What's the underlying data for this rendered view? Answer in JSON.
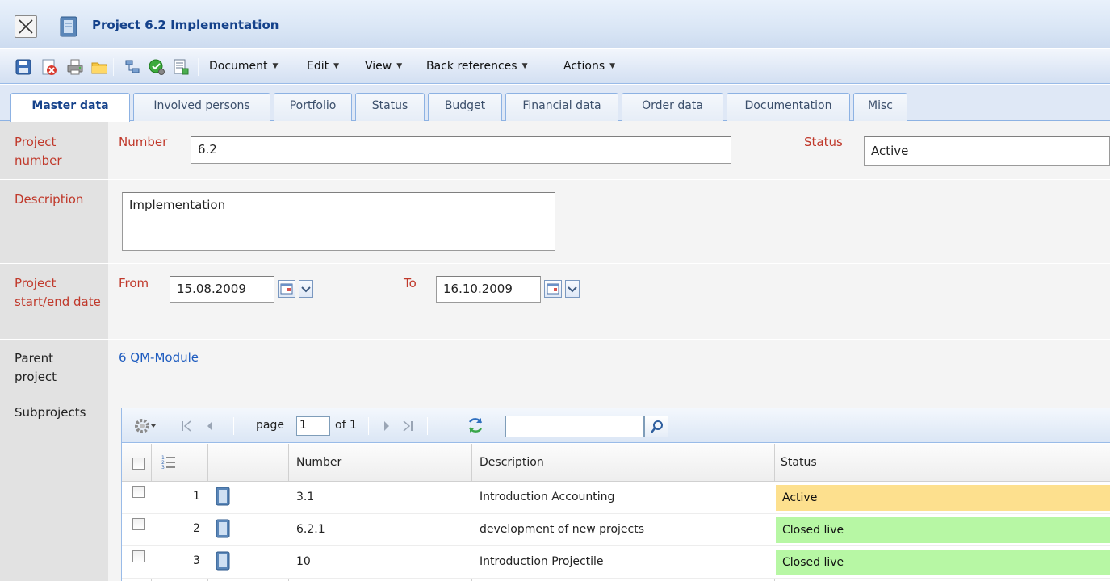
{
  "window": {
    "title": "Project 6.2 Implementation"
  },
  "toolbar": {
    "icons": [
      "save-icon",
      "delete-icon",
      "print-icon",
      "folder-icon",
      "hierarchy-icon",
      "check-icon",
      "report-icon"
    ],
    "menus": [
      {
        "label": "Document"
      },
      {
        "label": "Edit"
      },
      {
        "label": "View"
      },
      {
        "label": "Back references"
      },
      {
        "label": "Actions"
      }
    ]
  },
  "tabs": [
    {
      "label": "Master data",
      "active": true
    },
    {
      "label": "Involved persons"
    },
    {
      "label": "Portfolio"
    },
    {
      "label": "Status"
    },
    {
      "label": "Budget"
    },
    {
      "label": "Financial data"
    },
    {
      "label": "Order data"
    },
    {
      "label": "Documentation"
    },
    {
      "label": "Misc"
    }
  ],
  "form": {
    "project_number": {
      "label": "Project number",
      "number_label": "Number",
      "number_value": "6.2",
      "status_label": "Status",
      "status_value": "Active"
    },
    "description": {
      "label": "Description",
      "value": "Implementation"
    },
    "dates": {
      "label": "Project start/end date",
      "from_label": "From",
      "from_value": "15.08.2009",
      "to_label": "To",
      "to_value": "16.10.2009"
    },
    "parent": {
      "label": "Parent project",
      "value": "6 QM-Module"
    },
    "subprojects": {
      "label": "Subprojects"
    }
  },
  "grid": {
    "pager": {
      "page_label": "page",
      "page_value": "1",
      "of_label": "of 1"
    },
    "columns": [
      "Number",
      "Description",
      "Status"
    ],
    "rows": [
      {
        "index": "1",
        "number": "3.1",
        "description": "Introduction Accounting",
        "status": "Active",
        "status_color": "#fde08e"
      },
      {
        "index": "2",
        "number": "6.2.1",
        "description": "development of new projects",
        "status": "Closed live",
        "status_color": "#b7f7a4"
      },
      {
        "index": "3",
        "number": "10",
        "description": "Introduction Projectile",
        "status": "Closed live",
        "status_color": "#b7f7a4"
      }
    ]
  },
  "colors": {
    "title_text": "#15428b",
    "label_red": "#c0392b",
    "link_blue": "#1d5bbf"
  }
}
